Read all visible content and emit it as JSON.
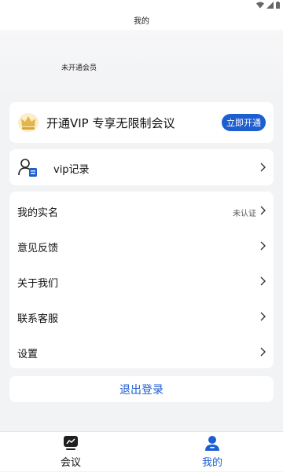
{
  "header": {
    "title": "我的"
  },
  "profile": {
    "member_status": "未开通会员"
  },
  "vip_banner": {
    "text": "开通VIP 专享无限制会议",
    "button_label": "立即开通",
    "crown_icon": "crown-icon"
  },
  "vip_record": {
    "label": "vip记录",
    "icon": "user-document-icon"
  },
  "menu": {
    "items": [
      {
        "label": "我的实名",
        "value": "未认证"
      },
      {
        "label": "意见反馈",
        "value": ""
      },
      {
        "label": "关于我们",
        "value": ""
      },
      {
        "label": "联系客服",
        "value": ""
      },
      {
        "label": "设置",
        "value": ""
      }
    ]
  },
  "logout": {
    "label": "退出登录"
  },
  "tabbar": {
    "tabs": [
      {
        "label": "会议",
        "icon": "meeting-icon",
        "active": false
      },
      {
        "label": "我的",
        "icon": "person-icon",
        "active": true
      }
    ]
  },
  "colors": {
    "accent": "#1e5fd0",
    "background": "#f2f3f5",
    "gold": "#e4b54a"
  }
}
